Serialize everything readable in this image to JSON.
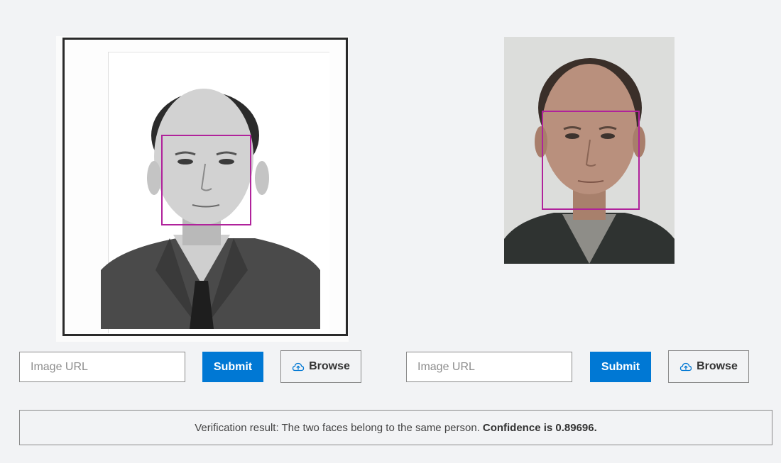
{
  "left_panel": {
    "url_placeholder": "Image URL",
    "submit_label": "Submit",
    "browse_label": "Browse",
    "browse_icon": "cloud-upload-icon"
  },
  "right_panel": {
    "url_placeholder": "Image URL",
    "submit_label": "Submit",
    "browse_label": "Browse",
    "browse_icon": "cloud-upload-icon"
  },
  "result": {
    "text": "Verification result: The two faces belong to the same person.",
    "confidence_text": "Confidence is 0.89696."
  },
  "colors": {
    "accent": "#0078d4",
    "face_box": "#b0229b",
    "background": "#f2f3f5"
  }
}
